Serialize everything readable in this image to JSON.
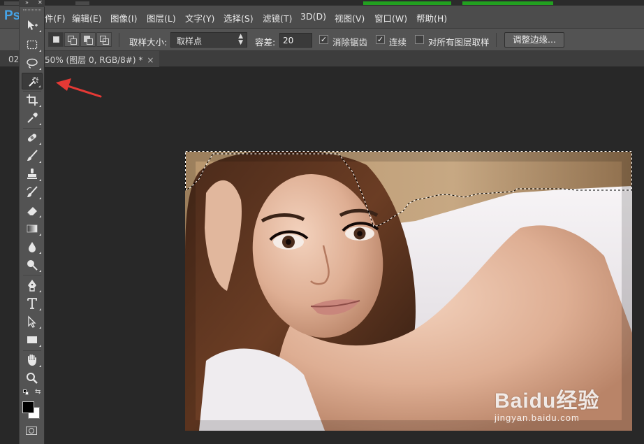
{
  "app": {
    "logo_text": "Ps"
  },
  "menu": {
    "items": [
      "件(F)",
      "编辑(E)",
      "图像(I)",
      "图层(L)",
      "文字(Y)",
      "选择(S)",
      "滤镜(T)",
      "3D(D)",
      "视图(V)",
      "窗口(W)",
      "帮助(H)"
    ]
  },
  "options": {
    "sample_size_label": "取样大小:",
    "sample_size_value": "取样点",
    "tolerance_label": "容差:",
    "tolerance_value": "20",
    "antialias_label": "消除锯齿",
    "antialias_checked": true,
    "contiguous_label": "连续",
    "contiguous_checked": true,
    "all_layers_label": "对所有图层取样",
    "all_layers_checked": false,
    "refine_edge_label": "调整边缘..."
  },
  "document": {
    "tab_prefix": "02",
    "tab_title": "50% (图层 0, RGB/8#) *",
    "tab_close": "×"
  },
  "toolbox": {
    "active_tool": "magic-wand",
    "foreground_color": "#000000",
    "background_color": "#ffffff"
  },
  "watermark": {
    "logo": "Baidu经验",
    "sub": "jingyan.baidu.com"
  },
  "colors": {
    "accent_logo": "#46a3e6",
    "arrow": "#e53935",
    "progress_green": "#22a020"
  }
}
